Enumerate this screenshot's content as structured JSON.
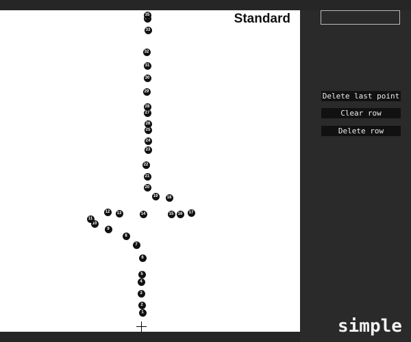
{
  "canvas": {
    "title": "Standard",
    "points": [
      "1",
      "2",
      "3",
      "4",
      "5",
      "6",
      "7",
      "8",
      "9",
      "10",
      "11",
      "12",
      "13",
      "14",
      "15",
      "16",
      "17",
      "18",
      "19",
      "20",
      "21",
      "22",
      "23",
      "24",
      "25",
      "26",
      "27",
      "28",
      "29",
      "30",
      "31",
      "32",
      "33",
      "34",
      "35"
    ],
    "cursor_icon": "crosshair-icon"
  },
  "panel": {
    "name_input_value": "",
    "delete_last_point_label": "Delete last point",
    "clear_row_label": "Clear row",
    "delete_row_label": "Delete row"
  },
  "logo": "simple :"
}
